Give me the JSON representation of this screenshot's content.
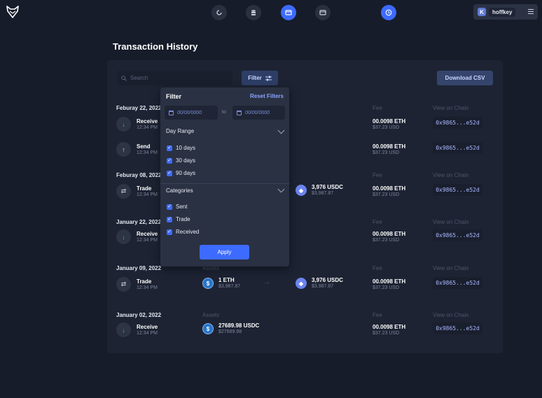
{
  "header": {
    "user_initial": "K",
    "user_name": "hoffkey"
  },
  "page_title": "Transaction History",
  "toolbar": {
    "search_placeholder": "Search",
    "filter_label": "Filter",
    "download_label": "Download CSV"
  },
  "columns": {
    "assets": "Assets",
    "fee": "Fee",
    "chain": "View on Chain"
  },
  "groups": [
    {
      "date": "Feburay 22, 2022",
      "transactions": [
        {
          "type": "Receive",
          "time": "12:34 PM",
          "icon": "arrow-down-icon",
          "fee": "00.0098 ETH",
          "fee_usd": "$37.23 USD",
          "chain": "0x9865...e52d"
        },
        {
          "type": "Send",
          "time": "12:34 PM",
          "icon": "arrow-up-icon",
          "fee": "00.0098 ETH",
          "fee_usd": "$37.23 USD",
          "chain": "0x9865...e52d"
        }
      ]
    },
    {
      "date": "Feburay 08, 2022",
      "transactions": [
        {
          "type": "Trade",
          "time": "12:34 PM",
          "icon": "swap-icon",
          "to_amount": "3,976 USDC",
          "to_usd": "$3,987.87",
          "fee": "00.0098 ETH",
          "fee_usd": "$37.23 USD",
          "chain": "0x9865...e52d"
        }
      ]
    },
    {
      "date": "January 22, 2022",
      "transactions": [
        {
          "type": "Receive",
          "time": "12:34 PM",
          "icon": "arrow-down-icon",
          "fee": "00.0098 ETH",
          "fee_usd": "$37.23 USD",
          "chain": "0x9865...e52d"
        }
      ]
    },
    {
      "date": "January 09, 2022",
      "transactions": [
        {
          "type": "Trade",
          "time": "12:34 PM",
          "icon": "swap-icon",
          "from_amount": "1 ETH",
          "from_usd": "$3,987.87",
          "to_amount": "3,976 USDC",
          "to_usd": "$3,987.87",
          "fee": "00.0098 ETH",
          "fee_usd": "$37.23 USD",
          "chain": "0x9865...e52d"
        }
      ]
    },
    {
      "date": "January 02, 2022",
      "transactions": [
        {
          "type": "Receive",
          "time": "12:34 PM",
          "icon": "arrow-down-icon",
          "from_amount": "27689.98 USDC",
          "from_usd": "$27689.98",
          "fee": "00.0098 ETH",
          "fee_usd": "$37.23 USD",
          "chain": "0x9865...e52d"
        }
      ]
    }
  ],
  "filter_panel": {
    "title": "Filter",
    "reset_label": "Reset Filters",
    "date_from_placeholder": "00/00/0000",
    "date_to_placeholder": "00/00/0000",
    "to_label": "to",
    "day_range_title": "Day Range",
    "day_ranges": [
      "10 days",
      "30 days",
      "90 days"
    ],
    "categories_title": "Categories",
    "categories": [
      "Sent",
      "Trade",
      "Received"
    ],
    "apply_label": "Apply"
  },
  "colors": {
    "background": "#171c2a",
    "card": "#1d2333",
    "accent": "#3d6bff",
    "panel": "#2a3142"
  }
}
